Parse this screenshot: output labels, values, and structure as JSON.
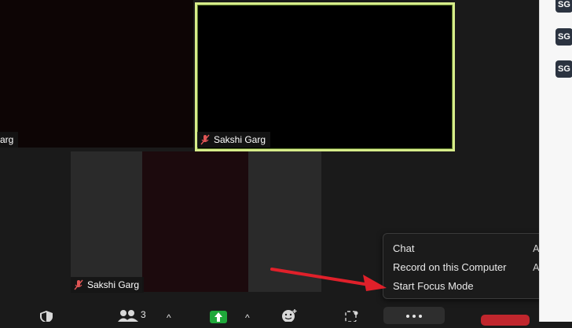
{
  "participants_panel": {
    "avatars": [
      "SG",
      "SG",
      "SG"
    ]
  },
  "tiles": {
    "top_left_name": "arg",
    "top_active_name": "Sakshi Garg",
    "bottom_name": "Sakshi Garg"
  },
  "toolbar": {
    "participants_count": "3",
    "caret": "^"
  },
  "more_menu": {
    "items": [
      {
        "label": "Chat",
        "shortcut": "Alt+H"
      },
      {
        "label": "Record on this Computer",
        "shortcut": "Alt+R"
      },
      {
        "label": "Start Focus Mode",
        "shortcut": ""
      }
    ]
  },
  "colors": {
    "active_border": "#d7ec8a",
    "arrow": "#e0202a",
    "end_button": "#c0262d",
    "share_button": "#1fa83a"
  }
}
